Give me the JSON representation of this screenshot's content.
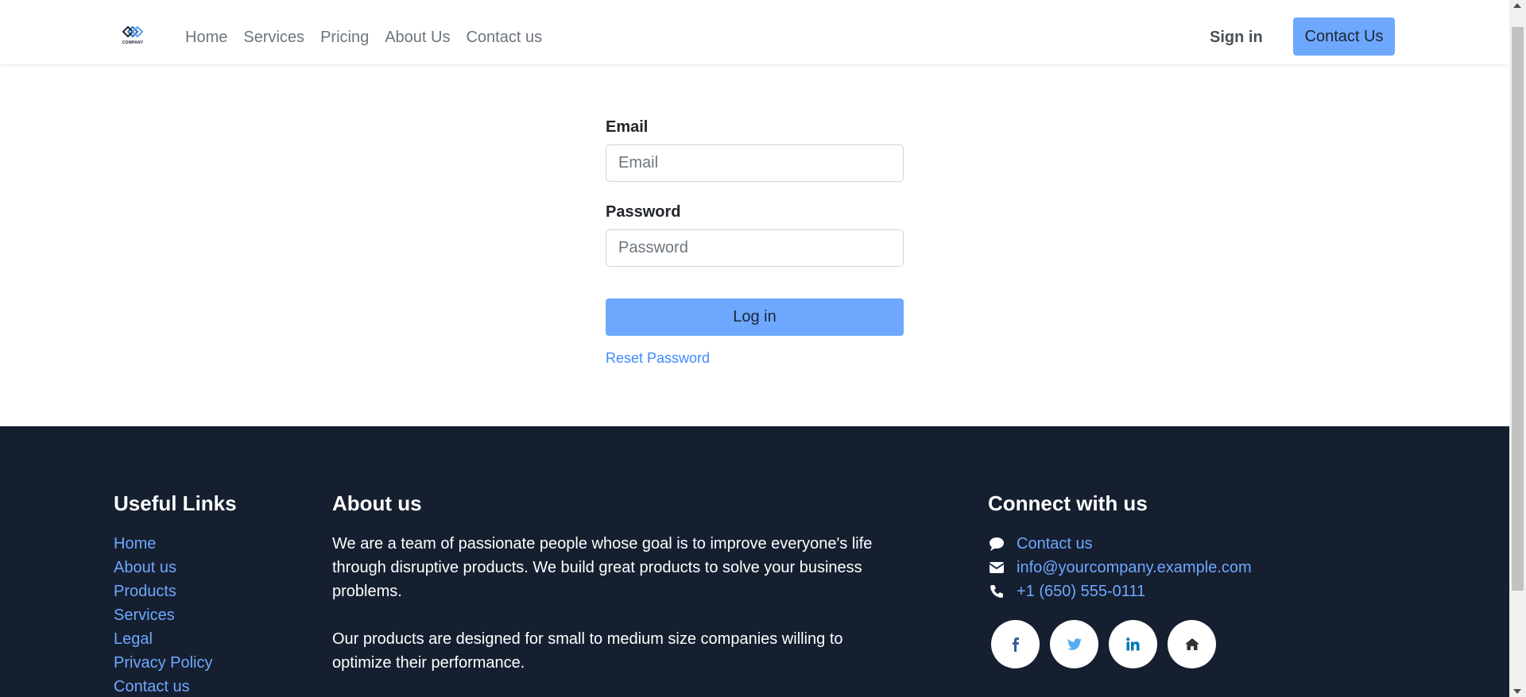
{
  "header": {
    "logo_text": "COMPANY",
    "nav": [
      "Home",
      "Services",
      "Pricing",
      "About Us",
      "Contact us"
    ],
    "sign_in": "Sign in",
    "contact_button": "Contact Us"
  },
  "form": {
    "email_label": "Email",
    "email_placeholder": "Email",
    "password_label": "Password",
    "password_placeholder": "Password",
    "login_button": "Log in",
    "reset_link": "Reset Password"
  },
  "footer": {
    "useful_links": {
      "title": "Useful Links",
      "items": [
        "Home",
        "About us",
        "Products",
        "Services",
        "Legal",
        "Privacy Policy",
        "Contact us"
      ]
    },
    "about": {
      "title": "About us",
      "p1": "We are a team of passionate people whose goal is to improve everyone's life through disruptive products. We build great products to solve your business problems.",
      "p2": "Our products are designed for small to medium size companies willing to optimize their performance."
    },
    "connect": {
      "title": "Connect with us",
      "items": [
        {
          "icon": "comment-icon",
          "text": "Contact us"
        },
        {
          "icon": "envelope-icon",
          "text": "info@yourcompany.example.com"
        },
        {
          "icon": "phone-icon",
          "text": "+1 (650) 555-0111"
        }
      ],
      "social": [
        "facebook-icon",
        "twitter-icon",
        "linkedin-icon",
        "home-icon"
      ]
    }
  },
  "colors": {
    "accent": "#6ea8fe",
    "link": "#3d8bfd",
    "footer_bg": "#161f30",
    "facebook": "#3b5998",
    "twitter": "#55acee",
    "linkedin": "#0077b5"
  }
}
